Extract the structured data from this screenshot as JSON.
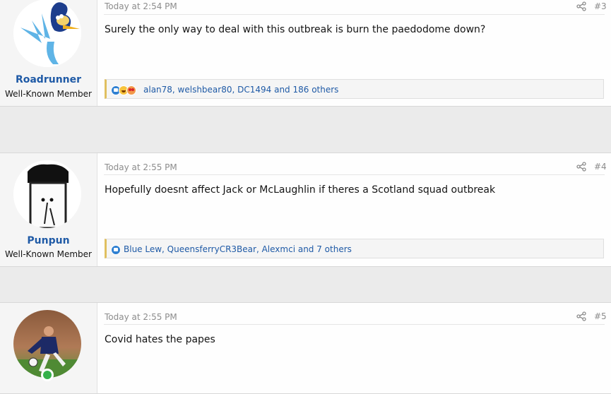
{
  "posts": [
    {
      "username": "Roadrunner",
      "user_title": "Well-Known Member",
      "avatar_icon": "roadrunner-avatar",
      "timestamp": "Today at 2:54 PM",
      "post_number": "#3",
      "message": "Surely the only way to deal with this outbreak is burn the paedodome down?",
      "reaction_icons": [
        "like-icon",
        "laugh-icon",
        "love-icon"
      ],
      "reactions_text": "alan78, welshbear80, DC1494 and 186 others"
    },
    {
      "username": "Punpun",
      "user_title": "Well-Known Member",
      "avatar_icon": "punpun-avatar",
      "timestamp": "Today at 2:55 PM",
      "post_number": "#4",
      "message": "Hopefully doesnt affect Jack or McLaughlin if theres a Scotland squad outbreak",
      "reaction_icons": [
        "like-icon"
      ],
      "reactions_text": "Blue Lew, QueensferryCR3Bear, Alexmci and 7 others"
    },
    {
      "username": "",
      "user_title": "",
      "avatar_icon": "footballer-avatar",
      "online_icon": "online-status-icon",
      "timestamp": "Today at 2:55 PM",
      "post_number": "#5",
      "message": "Covid hates the papes"
    }
  ],
  "colors": {
    "username": "#1f5aa6",
    "reaction_link": "#1f5aa6",
    "meta_text": "#8c8c8c",
    "online": "#35b14a"
  }
}
